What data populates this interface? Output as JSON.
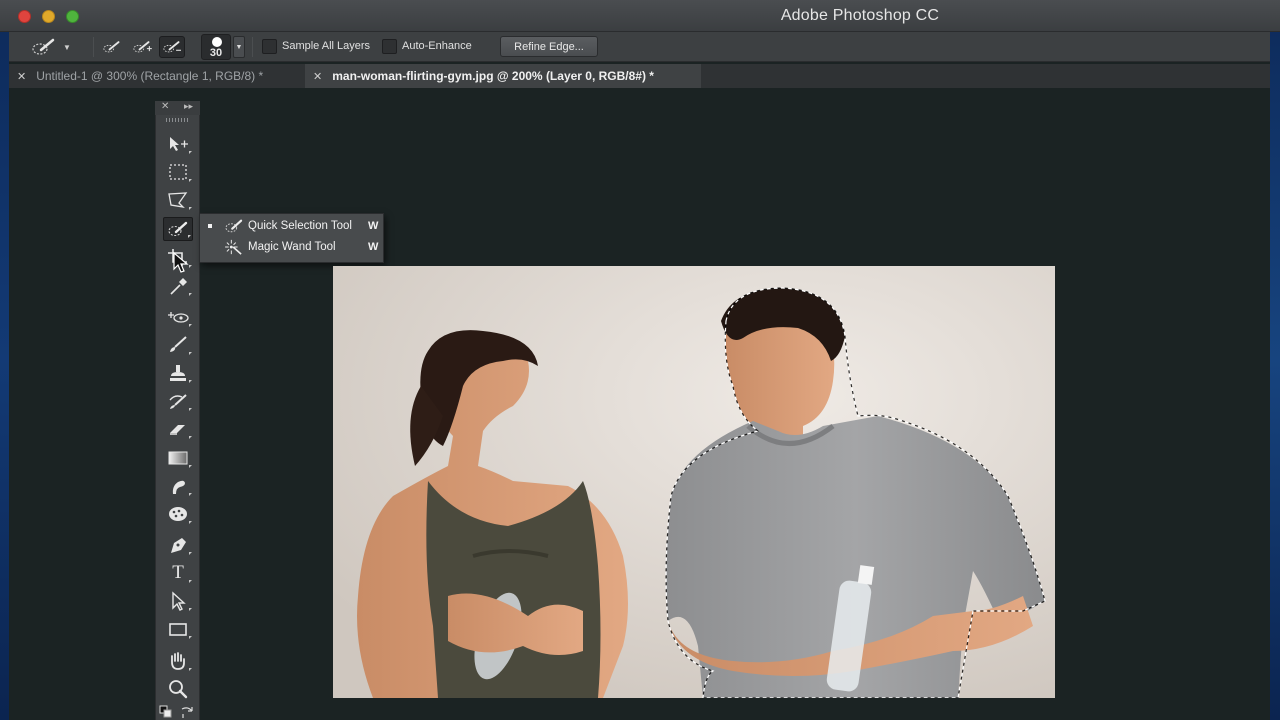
{
  "window": {
    "title": "Adobe Photoshop CC"
  },
  "options_bar": {
    "brush_size": "30",
    "sample_all_layers_label": "Sample All Layers",
    "sample_all_layers_checked": false,
    "auto_enhance_label": "Auto-Enhance",
    "auto_enhance_checked": false,
    "refine_edge_label": "Refine Edge..."
  },
  "tabs": [
    {
      "label": "Untitled-1 @ 300% (Rectangle 1, RGB/8) *",
      "active": false
    },
    {
      "label": "man-woman-flirting-gym.jpg @ 200% (Layer 0, RGB/8#) *",
      "active": true
    }
  ],
  "toolbox": {
    "selected_tool": "quick-selection-tool"
  },
  "flyout": {
    "items": [
      {
        "label": "Quick Selection Tool",
        "shortcut": "W",
        "selected": true,
        "icon": "quick-selection-icon"
      },
      {
        "label": "Magic Wand Tool",
        "shortcut": "W",
        "selected": false,
        "icon": "magic-wand-icon"
      }
    ]
  },
  "colors": {
    "workspace_bg": "#1b2323",
    "panel_bg": "#3f4244",
    "titlebar_bg": "#3b3e41",
    "selection_marquee": "#ffffff"
  }
}
